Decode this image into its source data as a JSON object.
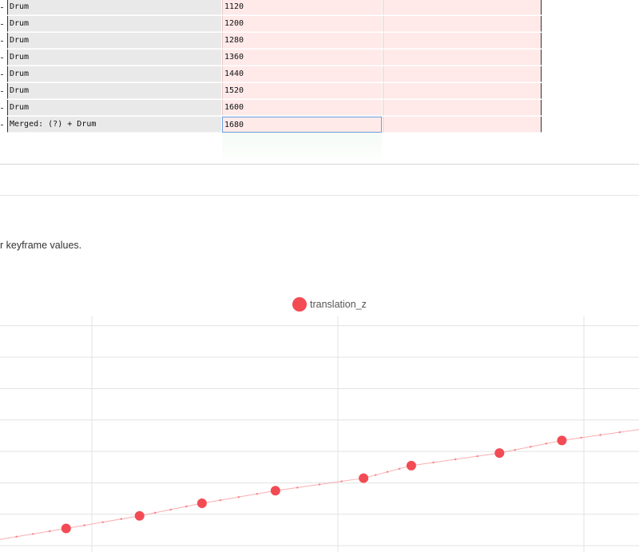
{
  "table": {
    "rows": [
      {
        "name": "Drum",
        "value": "1120"
      },
      {
        "name": "Drum",
        "value": "1200"
      },
      {
        "name": "Drum",
        "value": "1280"
      },
      {
        "name": "Drum",
        "value": "1360"
      },
      {
        "name": "Drum",
        "value": "1440"
      },
      {
        "name": "Drum",
        "value": "1520"
      },
      {
        "name": "Drum",
        "value": "1600"
      },
      {
        "name": "Merged: (?) + Drum",
        "value": "1680",
        "selected": true
      }
    ]
  },
  "description": "r keyframe values.",
  "colors": {
    "series": "#f24b54",
    "grid": "#e3e3e3",
    "name_cell": "#e9e9e9",
    "value_cell": "#ffe9e9",
    "selection": "#6a9fe0"
  },
  "chart_data": {
    "type": "line",
    "legend": {
      "position": "top-center",
      "entries": [
        "translation_z"
      ]
    },
    "grid": true,
    "series": [
      {
        "name": "translation_z",
        "color": "#f24b54",
        "keyframes": [
          {
            "x": 2.2,
            "y": 1.55
          },
          {
            "x": 3.2,
            "y": 1.95
          },
          {
            "x": 4.05,
            "y": 2.35
          },
          {
            "x": 5.05,
            "y": 2.75
          },
          {
            "x": 6.25,
            "y": 3.15
          },
          {
            "x": 6.9,
            "y": 3.55
          },
          {
            "x": 8.1,
            "y": 3.95
          },
          {
            "x": 8.95,
            "y": 4.35
          }
        ],
        "line_start": {
          "x": 1.3,
          "y": 1.2
        },
        "line_end": {
          "x": 10.0,
          "y": 4.7
        }
      }
    ],
    "xlim": [
      1.3,
      10.0
    ],
    "ylim": [
      0.8,
      8.3
    ],
    "x_gridlines": [
      2.55,
      5.9,
      9.25
    ],
    "y_gridlines": [
      1.0,
      2.0,
      3.0,
      4.0,
      5.0,
      6.0,
      7.0,
      8.0
    ]
  }
}
